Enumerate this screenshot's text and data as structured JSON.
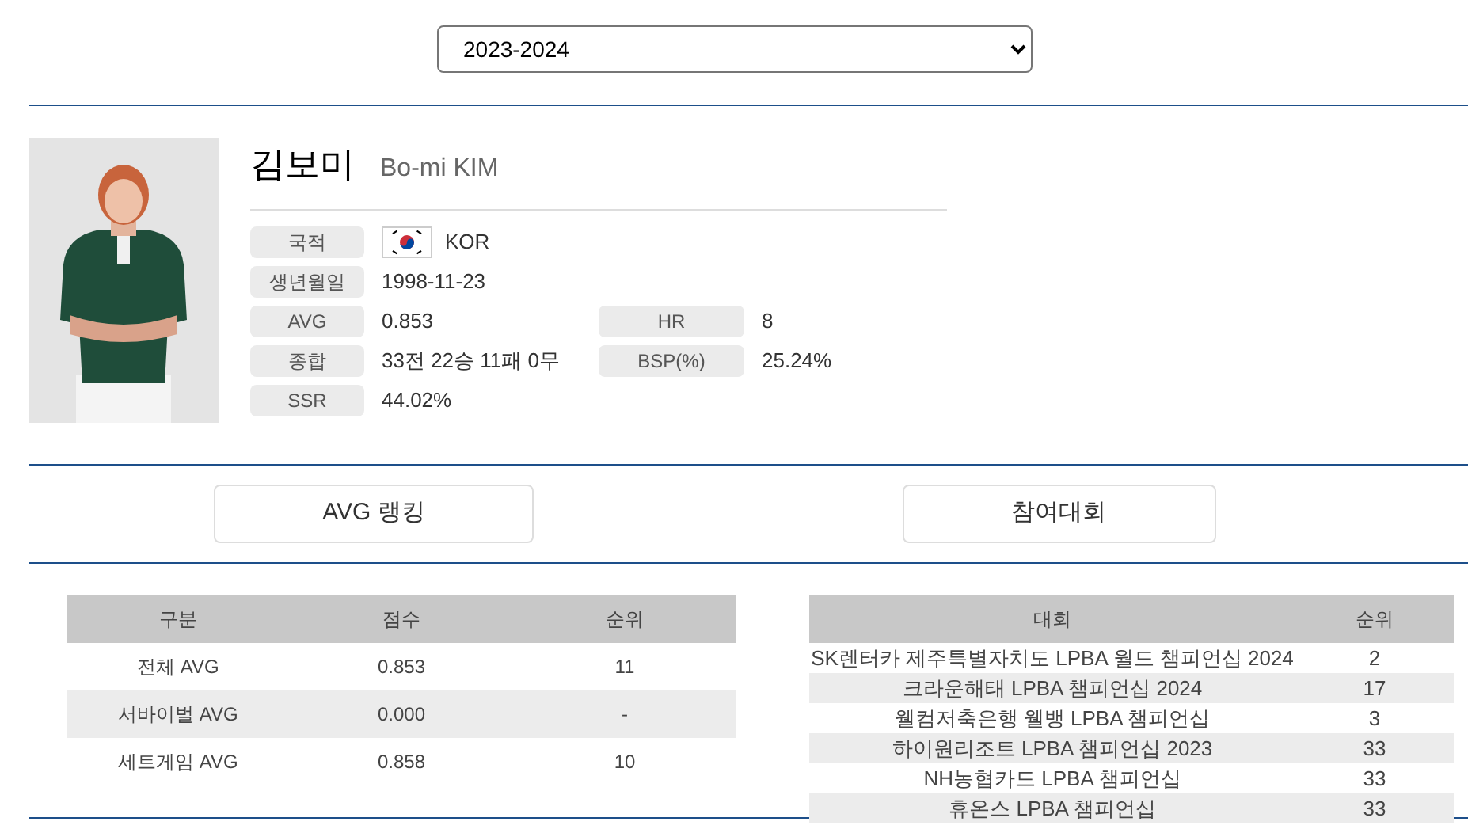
{
  "season_select": {
    "value": "2023-2024"
  },
  "player": {
    "name": "김보미",
    "name_en": "Bo-mi KIM",
    "photo": {
      "kind": "picture"
    },
    "info": [
      [
        {
          "label": "국적",
          "value": "KOR",
          "flag": true
        }
      ],
      [
        {
          "label": "생년월일",
          "value": "1998-11-23"
        }
      ],
      [
        {
          "label": "AVG",
          "value": "0.853"
        },
        {
          "label": "HR",
          "value": "8"
        }
      ],
      [
        {
          "label": "종합",
          "value": "33전 22승 11패 0무"
        },
        {
          "label": "BSP(%)",
          "value": "25.24%"
        }
      ],
      [
        {
          "label": "SSR",
          "value": "44.02%"
        }
      ]
    ]
  },
  "tabs": [
    {
      "label": "AVG 랭킹"
    },
    {
      "label": "참여대회"
    }
  ],
  "avg_table": {
    "columns": [
      "구분",
      "점수",
      "순위"
    ],
    "rows": [
      [
        "전체 AVG",
        "0.853",
        "11"
      ],
      [
        "서바이벌 AVG",
        "0.000",
        "-"
      ],
      [
        "세트게임 AVG",
        "0.858",
        "10"
      ]
    ]
  },
  "tournament_table": {
    "columns": [
      "대회",
      "순위"
    ],
    "rows": [
      [
        "SK렌터카 제주특별자치도 LPBA 월드 챔피언십 2024",
        "2"
      ],
      [
        "크라운해태 LPBA 챔피언십 2024",
        "17"
      ],
      [
        "웰컴저축은행 웰뱅 LPBA 챔피언십",
        "3"
      ],
      [
        "하이원리조트 LPBA 챔피언십 2023",
        "33"
      ],
      [
        "NH농협카드 LPBA 챔피언십",
        "33"
      ],
      [
        "휴온스 LPBA 챔피언십",
        "33"
      ]
    ]
  }
}
